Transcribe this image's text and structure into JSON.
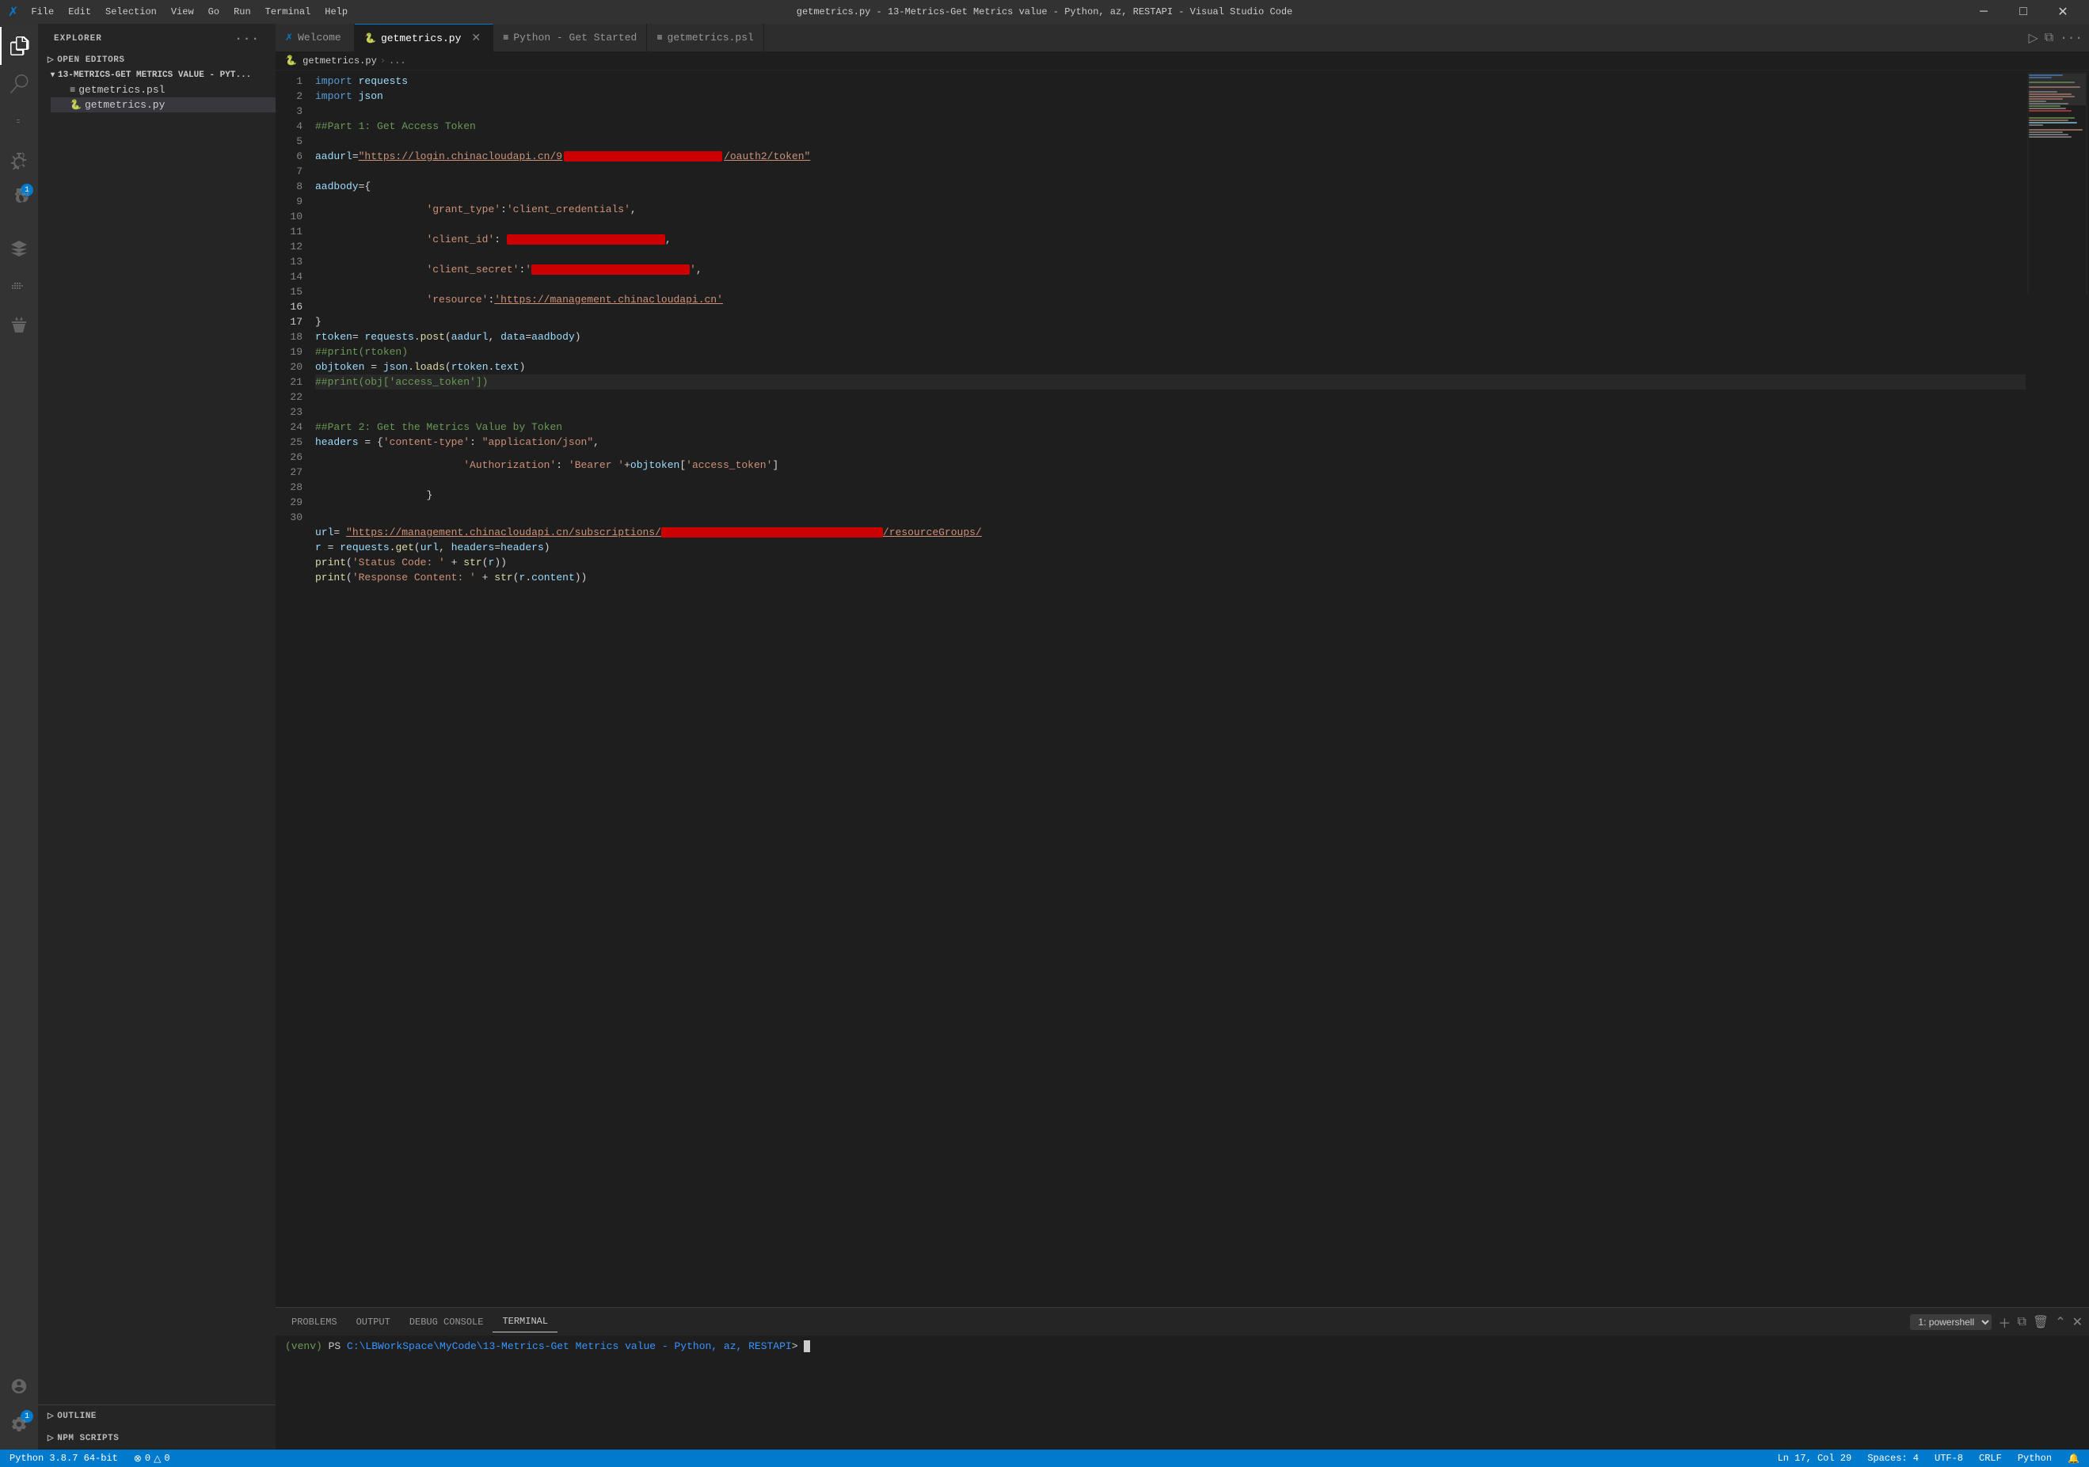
{
  "titlebar": {
    "title": "getmetrics.py - 13-Metrics-Get Metrics value - Python, az, RESTAPI - Visual Studio Code",
    "logo": "✗",
    "menu": [
      "File",
      "Edit",
      "Selection",
      "View",
      "Go",
      "Run",
      "Terminal",
      "Help"
    ],
    "controls": [
      "─",
      "□",
      "✕"
    ]
  },
  "activity_bar": {
    "icons": [
      {
        "name": "explorer-icon",
        "symbol": "⎘",
        "active": true
      },
      {
        "name": "search-icon",
        "symbol": "🔍",
        "active": false
      },
      {
        "name": "source-control-icon",
        "symbol": "⎇",
        "active": false
      },
      {
        "name": "debug-icon",
        "symbol": "▷",
        "active": false
      },
      {
        "name": "extensions-icon",
        "symbol": "⊞",
        "active": false,
        "badge": "1"
      },
      {
        "name": "remote-icon",
        "symbol": "△",
        "active": false
      },
      {
        "name": "docker-icon",
        "symbol": "🐳",
        "active": false
      },
      {
        "name": "terminal-icon",
        "symbol": "⬚",
        "active": false
      }
    ],
    "bottom_icons": [
      {
        "name": "account-icon",
        "symbol": "👤"
      },
      {
        "name": "settings-icon",
        "symbol": "⚙",
        "badge": "1"
      }
    ]
  },
  "sidebar": {
    "title": "EXPLORER",
    "sections": {
      "open_editors": "OPEN EDITORS",
      "folder_name": "13-METRICS-GET METRICS VALUE - PYT...",
      "files": [
        {
          "name": "getmetrics.psl",
          "icon": "≡",
          "type": "psl"
        },
        {
          "name": "getmetrics.py",
          "icon": "🐍",
          "type": "py",
          "active": true
        }
      ],
      "outline": "OUTLINE",
      "npm_scripts": "NPM SCRIPTS"
    }
  },
  "tabs": [
    {
      "label": "Welcome",
      "icon": "✗",
      "active": false,
      "closable": false
    },
    {
      "label": "getmetrics.py",
      "icon": "🐍",
      "active": true,
      "closable": true,
      "modified": false
    },
    {
      "label": "Python - Get Started",
      "icon": "≡",
      "active": false,
      "closable": false
    },
    {
      "label": "getmetrics.psl",
      "icon": "≡",
      "active": false,
      "closable": false
    }
  ],
  "breadcrumb": {
    "parts": [
      "getmetrics.py",
      "..."
    ]
  },
  "code": {
    "lines": [
      {
        "num": 1,
        "content": "import requests"
      },
      {
        "num": 2,
        "content": "import json"
      },
      {
        "num": 3,
        "content": ""
      },
      {
        "num": 4,
        "content": "##Part 1: Get Access Token"
      },
      {
        "num": 5,
        "content": ""
      },
      {
        "num": 6,
        "content": "aadurl=\"https://login.chinacloudapi.cn/9[REDACTED]/oauth2/token\""
      },
      {
        "num": 7,
        "content": ""
      },
      {
        "num": 8,
        "content": "aadbody={"
      },
      {
        "num": 9,
        "content": "      'grant_type':'client_credentials',"
      },
      {
        "num": 10,
        "content": "      'client_id': [REDACTED],"
      },
      {
        "num": 11,
        "content": "      'client_secret':'[REDACTED]',"
      },
      {
        "num": 12,
        "content": "      'resource':'https://management.chinacloudapi.cn'"
      },
      {
        "num": 13,
        "content": "}"
      },
      {
        "num": 14,
        "content": "rtoken= requests.post(aadurl, data=aadbody)"
      },
      {
        "num": 15,
        "content": "##print(rtoken)"
      },
      {
        "num": 16,
        "content": "objtoken = json.loads(rtoken.text)"
      },
      {
        "num": 17,
        "content": "##print(obj['access_token'])"
      },
      {
        "num": 18,
        "content": ""
      },
      {
        "num": 19,
        "content": ""
      },
      {
        "num": 20,
        "content": "##Part 2: Get the Metrics Value by Token"
      },
      {
        "num": 21,
        "content": "headers = {'content-type': \"application/json\","
      },
      {
        "num": 22,
        "content": "            'Authorization': 'Bearer '+objtoken['access_token']"
      },
      {
        "num": 23,
        "content": "      }"
      },
      {
        "num": 24,
        "content": ""
      },
      {
        "num": 25,
        "content": "url= \"https://management.chinacloudapi.cn/subscriptions/[REDACTED]/resourceGroups/"
      },
      {
        "num": 26,
        "content": "r = requests.get(url, headers=headers)"
      },
      {
        "num": 27,
        "content": "print('Status Code: ' + str(r))"
      },
      {
        "num": 28,
        "content": "print('Response Content: ' + str(r.content))"
      },
      {
        "num": 29,
        "content": ""
      },
      {
        "num": 30,
        "content": ""
      }
    ],
    "active_line": 17
  },
  "panel": {
    "tabs": [
      "PROBLEMS",
      "OUTPUT",
      "DEBUG CONSOLE",
      "TERMINAL"
    ],
    "active_tab": "TERMINAL",
    "terminal_selector": "1: powershell",
    "terminal_content": "(venv) PS C:\\LBWorkSpace\\MyCode\\13-Metrics-Get Metrics value - Python, az, RESTAPI> []"
  },
  "status_bar": {
    "left": [
      {
        "label": "Python 3.8.7 64-bit",
        "name": "python-version"
      },
      {
        "label": "⊗ 0  △ 0",
        "name": "errors-warnings"
      }
    ],
    "right": [
      {
        "label": "Ln 17, Col 29",
        "name": "cursor-position"
      },
      {
        "label": "Spaces: 4",
        "name": "indent"
      },
      {
        "label": "UTF-8",
        "name": "encoding"
      },
      {
        "label": "CRLF",
        "name": "line-ending"
      },
      {
        "label": "Python",
        "name": "language-mode"
      }
    ]
  }
}
